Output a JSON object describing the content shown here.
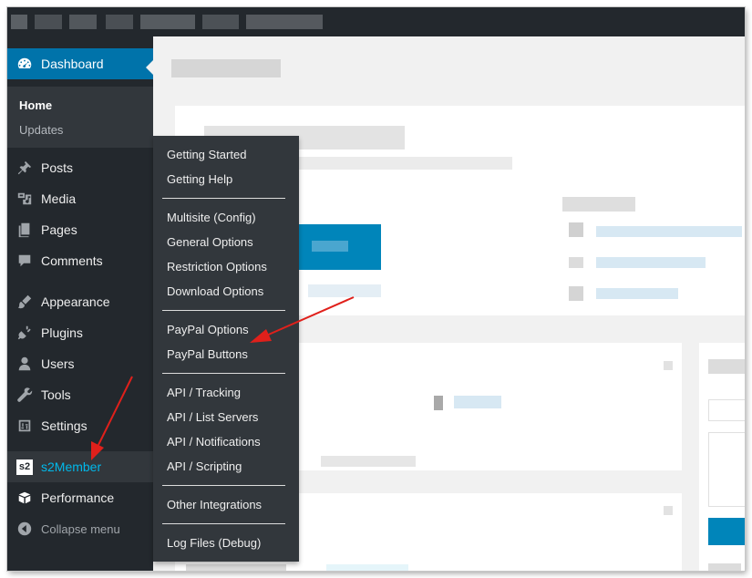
{
  "sidebar": {
    "dashboard": "Dashboard",
    "home": "Home",
    "updates": "Updates",
    "posts": "Posts",
    "media": "Media",
    "pages": "Pages",
    "comments": "Comments",
    "appearance": "Appearance",
    "plugins": "Plugins",
    "users": "Users",
    "tools": "Tools",
    "settings": "Settings",
    "s2member": "s2Member",
    "s2member_icon_text": "s2",
    "performance": "Performance",
    "collapse": "Collapse menu"
  },
  "flyout": {
    "getting_started": "Getting Started",
    "getting_help": "Getting Help",
    "multisite": "Multisite (Config)",
    "general": "General Options",
    "restriction": "Restriction Options",
    "download": "Download Options",
    "paypal_options": "PayPal Options",
    "paypal_buttons": "PayPal Buttons",
    "api_tracking": "API / Tracking",
    "api_list_servers": "API / List Servers",
    "api_notifications": "API / Notifications",
    "api_scripting": "API / Scripting",
    "other_integrations": "Other Integrations",
    "log_files": "Log Files (Debug)"
  },
  "colors": {
    "admin_bg": "#23282d",
    "submenu_bg": "#32373c",
    "accent": "#0073aa",
    "s2_text": "#00b9eb",
    "annotation": "#e0201b"
  },
  "icons": [
    "dashboard-icon",
    "posts-icon",
    "media-icon",
    "pages-icon",
    "comments-icon",
    "appearance-icon",
    "plugins-icon",
    "users-icon",
    "tools-icon",
    "settings-icon",
    "s2member-icon",
    "performance-icon",
    "collapse-icon"
  ]
}
